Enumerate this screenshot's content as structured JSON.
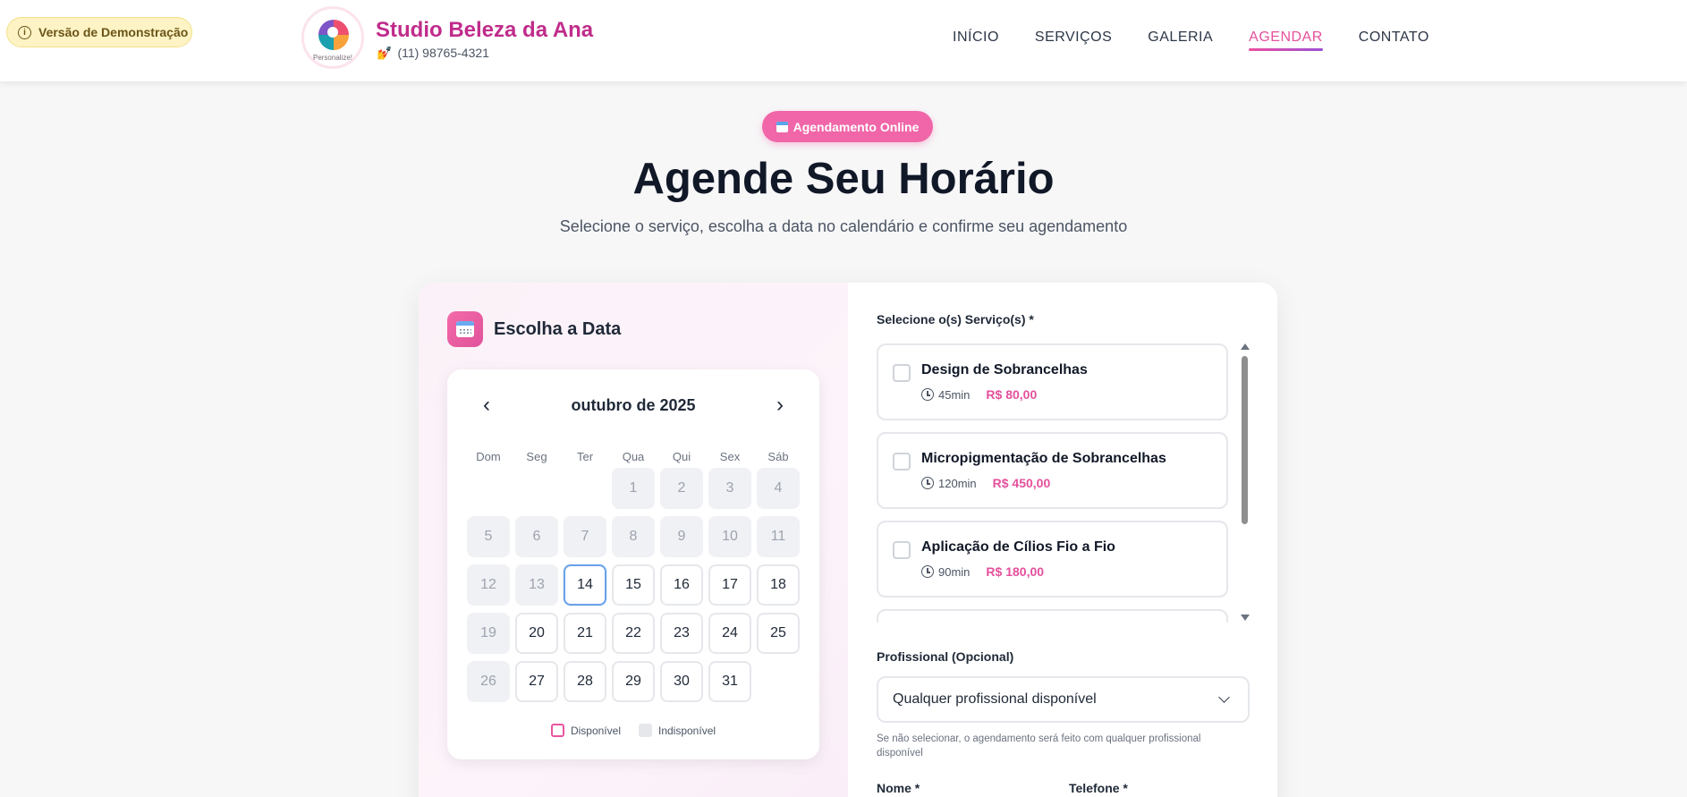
{
  "demo_badge": {
    "label": "Versão de Demonstração",
    "icon": "info-icon"
  },
  "brand": {
    "name": "Studio Beleza da Ana",
    "phone": "(11) 98765-4321",
    "phone_icon": "💅",
    "logo_text": "Personalize!"
  },
  "nav": [
    {
      "label": "INÍCIO",
      "active": false
    },
    {
      "label": "SERVIÇOS",
      "active": false
    },
    {
      "label": "GALERIA",
      "active": false
    },
    {
      "label": "AGENDAR",
      "active": true
    },
    {
      "label": "CONTATO",
      "active": false
    }
  ],
  "hero": {
    "pill": "Agendamento Online",
    "title": "Agende Seu Horário",
    "subtitle": "Selecione o serviço, escolha a data no calendário e confirme seu agendamento"
  },
  "date_section": {
    "title": "Escolha a Data",
    "month": "outubro de 2025",
    "prev": "‹",
    "next": "›",
    "weekdays": [
      "Dom",
      "Seg",
      "Ter",
      "Qua",
      "Qui",
      "Sex",
      "Sáb"
    ],
    "leading_blanks": 3,
    "days": [
      {
        "n": "1",
        "s": "unavailable"
      },
      {
        "n": "2",
        "s": "unavailable"
      },
      {
        "n": "3",
        "s": "unavailable"
      },
      {
        "n": "4",
        "s": "unavailable"
      },
      {
        "n": "5",
        "s": "unavailable"
      },
      {
        "n": "6",
        "s": "unavailable"
      },
      {
        "n": "7",
        "s": "unavailable"
      },
      {
        "n": "8",
        "s": "unavailable"
      },
      {
        "n": "9",
        "s": "unavailable"
      },
      {
        "n": "10",
        "s": "unavailable"
      },
      {
        "n": "11",
        "s": "unavailable"
      },
      {
        "n": "12",
        "s": "unavailable"
      },
      {
        "n": "13",
        "s": "unavailable"
      },
      {
        "n": "14",
        "s": "today"
      },
      {
        "n": "15",
        "s": "available"
      },
      {
        "n": "16",
        "s": "available"
      },
      {
        "n": "17",
        "s": "available"
      },
      {
        "n": "18",
        "s": "available"
      },
      {
        "n": "19",
        "s": "unavailable"
      },
      {
        "n": "20",
        "s": "available"
      },
      {
        "n": "21",
        "s": "available"
      },
      {
        "n": "22",
        "s": "available"
      },
      {
        "n": "23",
        "s": "available"
      },
      {
        "n": "24",
        "s": "available"
      },
      {
        "n": "25",
        "s": "available"
      },
      {
        "n": "26",
        "s": "unavailable"
      },
      {
        "n": "27",
        "s": "available"
      },
      {
        "n": "28",
        "s": "available"
      },
      {
        "n": "29",
        "s": "available"
      },
      {
        "n": "30",
        "s": "available"
      },
      {
        "n": "31",
        "s": "available"
      }
    ],
    "legend": {
      "available": "Disponível",
      "unavailable": "Indisponível"
    }
  },
  "services_section": {
    "label": "Selecione o(s) Serviço(s) *",
    "items": [
      {
        "name": "Design de Sobrancelhas",
        "duration": "45min",
        "price": "R$ 80,00"
      },
      {
        "name": "Micropigmentação de Sobrancelhas",
        "duration": "120min",
        "price": "R$ 450,00"
      },
      {
        "name": "Aplicação de Cílios Fio a Fio",
        "duration": "90min",
        "price": "R$ 180,00"
      }
    ]
  },
  "professional": {
    "label": "Profissional (Opcional)",
    "selected": "Qualquer profissional disponível",
    "hint": "Se não selecionar, o agendamento será feito com qualquer profissional disponível"
  },
  "form": {
    "name_label": "Nome *",
    "phone_label": "Telefone *"
  },
  "colors": {
    "accent": "#e4509c",
    "brand": "#c02c8b",
    "today_border": "#6aa2ea"
  }
}
